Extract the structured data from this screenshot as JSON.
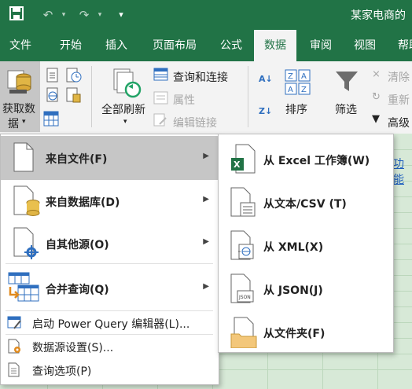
{
  "title_bar": {
    "document_title": "某家电商的"
  },
  "tabs": [
    {
      "label": "文件"
    },
    {
      "label": "开始"
    },
    {
      "label": "插入"
    },
    {
      "label": "页面布局"
    },
    {
      "label": "公式"
    },
    {
      "label": "数据"
    },
    {
      "label": "审阅"
    },
    {
      "label": "视图"
    },
    {
      "label": "帮助"
    }
  ],
  "ribbon": {
    "get_data_line1": "获取数",
    "get_data_line2": "据",
    "refresh_all": "全部刷新",
    "queries_connections": "查询和连接",
    "properties": "属性",
    "edit_links": "编辑链接",
    "sort": "排序",
    "filter": "筛选",
    "clear": "清除",
    "reapply": "重新",
    "advanced": "高级"
  },
  "sheet": {
    "visible_text": "功能"
  },
  "menu": {
    "items": [
      {
        "label": "来自文件(F)"
      },
      {
        "label": "来自数据库(D)"
      },
      {
        "label": "自其他源(O)"
      },
      {
        "label": "合并查询(Q)"
      }
    ],
    "power_query": "启动 Power Query 编辑器(L)...",
    "data_source_settings": "数据源设置(S)...",
    "query_options": "查询选项(P)"
  },
  "submenu": {
    "items": [
      {
        "label": "从 Excel 工作簿(W)"
      },
      {
        "label": "从文本/CSV (T)"
      },
      {
        "label": "从 XML(X)"
      },
      {
        "label": "从 JSON(J)"
      },
      {
        "label": "从文件夹(F)"
      }
    ]
  }
}
